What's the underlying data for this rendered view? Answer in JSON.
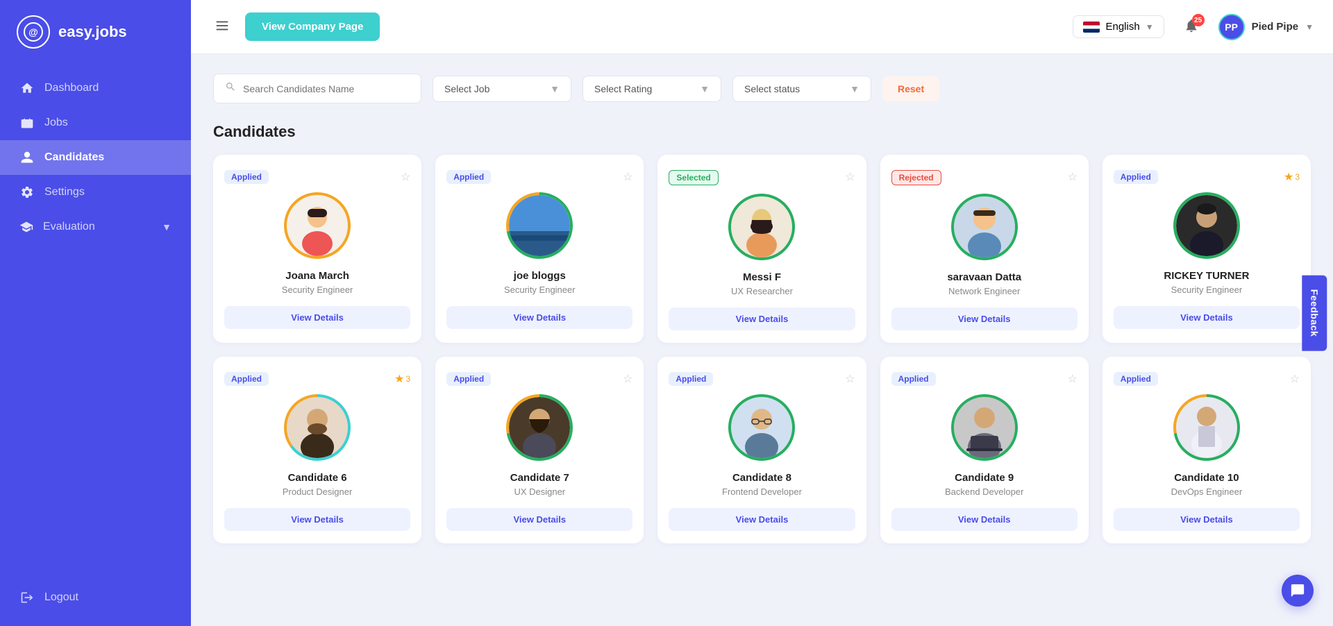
{
  "sidebar": {
    "logo_text": "easy.jobs",
    "nav_items": [
      {
        "id": "dashboard",
        "label": "Dashboard",
        "icon": "home"
      },
      {
        "id": "jobs",
        "label": "Jobs",
        "icon": "briefcase"
      },
      {
        "id": "candidates",
        "label": "Candidates",
        "icon": "user",
        "active": true
      },
      {
        "id": "settings",
        "label": "Settings",
        "icon": "gear"
      },
      {
        "id": "evaluation",
        "label": "Evaluation",
        "icon": "graduation",
        "has_arrow": true
      }
    ],
    "logout_label": "Logout"
  },
  "header": {
    "view_company_btn": "View Company Page",
    "language": "English",
    "notif_count": "25",
    "user_name": "Pied Pipe"
  },
  "filters": {
    "search_placeholder": "Search Candidates Name",
    "select_job": "Select Job",
    "select_rating": "Select Rating",
    "select_status": "Select status",
    "reset_btn": "Reset"
  },
  "page_title": "Candidates",
  "candidates": [
    {
      "name": "Joana March",
      "role": "Security Engineer",
      "status": "Applied",
      "status_type": "applied",
      "ring": "orange",
      "star_filled": 0,
      "view_details": "View Details",
      "has_photo": false
    },
    {
      "name": "joe bloggs",
      "role": "Security Engineer",
      "status": "Applied",
      "status_type": "applied",
      "ring": "orange-green",
      "star_filled": 0,
      "view_details": "View Details",
      "has_photo": true,
      "photo_color": "#5bc8d0"
    },
    {
      "name": "Messi F",
      "role": "UX Researcher",
      "status": "Selected",
      "status_type": "selected",
      "ring": "green",
      "star_filled": 0,
      "view_details": "View Details",
      "has_photo": false
    },
    {
      "name": "saravaan Datta",
      "role": "Network Engineer",
      "status": "Rejected",
      "status_type": "rejected",
      "ring": "green",
      "star_filled": 0,
      "view_details": "View Details",
      "has_photo": true,
      "photo_color": "#b0c4de"
    },
    {
      "name": "RICKEY TURNER",
      "role": "Security Engineer",
      "status": "Applied",
      "status_type": "applied",
      "ring": "green",
      "star_filled": 3,
      "view_details": "View Details",
      "has_photo": true,
      "photo_color": "#333"
    },
    {
      "name": "Candidate 6",
      "role": "Product Designer",
      "status": "Applied",
      "status_type": "applied",
      "ring": "teal-orange",
      "star_filled": 3,
      "view_details": "View Details",
      "has_photo": true,
      "photo_color": "#555"
    },
    {
      "name": "Candidate 7",
      "role": "UX Designer",
      "status": "Applied",
      "status_type": "applied",
      "ring": "green-orange",
      "star_filled": 0,
      "view_details": "View Details",
      "has_photo": true,
      "photo_color": "#7a5c4a"
    },
    {
      "name": "Candidate 8",
      "role": "Frontend Developer",
      "status": "Applied",
      "status_type": "applied",
      "ring": "green",
      "star_filled": 0,
      "view_details": "View Details",
      "has_photo": true,
      "photo_color": "#4a7a9b"
    },
    {
      "name": "Candidate 9",
      "role": "Backend Developer",
      "status": "Applied",
      "status_type": "applied",
      "ring": "green",
      "star_filled": 0,
      "view_details": "View Details",
      "has_photo": true,
      "photo_color": "#5a5a7a"
    },
    {
      "name": "Candidate 10",
      "role": "DevOps Engineer",
      "status": "Applied",
      "status_type": "applied",
      "ring": "green-orange",
      "star_filled": 0,
      "view_details": "View Details",
      "has_photo": true,
      "photo_color": "#6a8a6a"
    }
  ],
  "feedback_label": "Feedback"
}
